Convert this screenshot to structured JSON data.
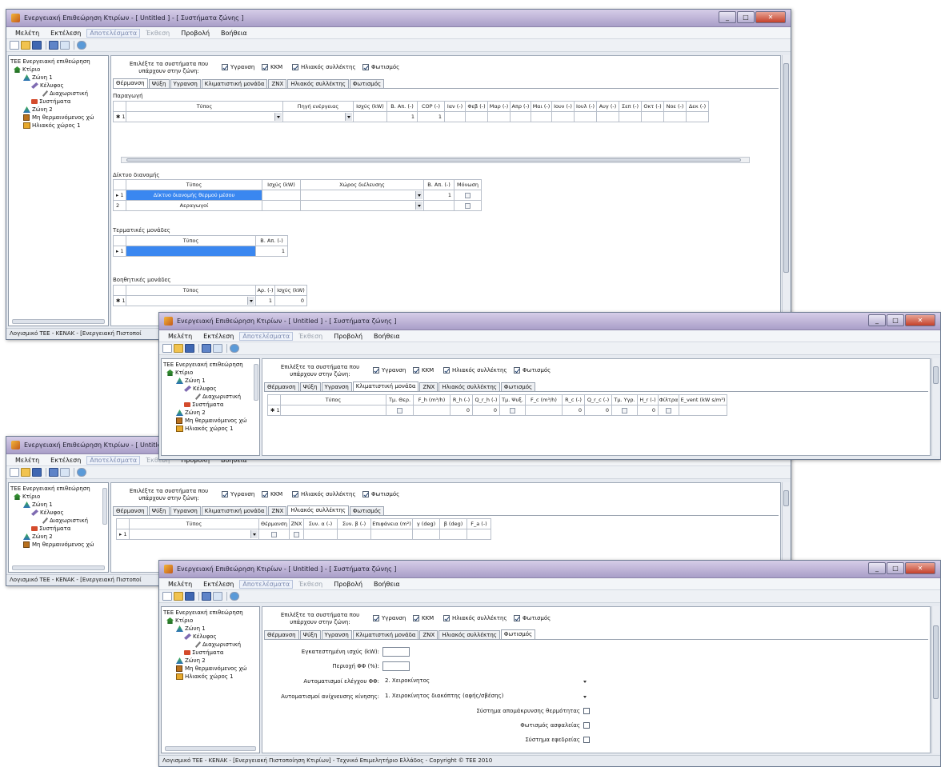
{
  "app": {
    "title": "Ενεργειακή Επιθεώρηση Κτιρίων - [ Untitled ] - [ Συστήματα ζώνης ]",
    "menu": [
      "Μελέτη",
      "Εκτέλεση",
      "Αποτελέσματα",
      "Έκθεση",
      "Προβολή",
      "Βοήθεια"
    ],
    "status_full": "Λογισμικό ΤΕΕ - KENAK - [Ενεργειακή Πιστοποίηση Κτιρίων] - Τεχνικό Επιμελητήριο Ελλάδος - Copyright © TEE 2010",
    "status_short": "Λογισμικό ΤΕΕ - KENAK - [Ενεργειακή Πιστοποί"
  },
  "tree": {
    "root": "ΤΕΕ Ενεργειακή επιθεώρηση",
    "building": "Κτίριο",
    "zone1": "Ζώνη 1",
    "shell": "Κέλυφος",
    "partitions": "Διαχωριστική",
    "systems": "Συστήματα",
    "zone2": "Ζώνη 2",
    "unheated": "Μη θερμαινόμενος χώ",
    "solar_space": "Ηλιακός χώρος 1"
  },
  "systems_select": {
    "label": "Επιλέξτε τα συστήματα που υπάρχουν στην ζώνη:",
    "options": [
      "Υγρανση",
      "ΚΚΜ",
      "Ηλιακός συλλέκτης",
      "Φωτισμός"
    ]
  },
  "tabs": [
    "Θέρμανση",
    "Ψύξη",
    "Υγρανση",
    "Κλιματιστική μονάδα",
    "ΖΝΧ",
    "Ηλιακός συλλέκτης",
    "Φωτισμός"
  ],
  "heating": {
    "production_title": "Παραγωγή",
    "production_headers": [
      "Τύπος",
      "Πηγή ενέργειας",
      "Ισχύς (kW)",
      "Β. Απ. (-)",
      "COP (-)",
      "Ιαν (-)",
      "Φεβ (-)",
      "Μαρ (-)",
      "Απρ (-)",
      "Μαι (-)",
      "Ιουν (-)",
      "Ιουλ (-)",
      "Αυγ (-)",
      "Σεπ (-)",
      "Οκτ (-)",
      "Νοε (-)",
      "Δεκ (-)"
    ],
    "production_row": {
      "marker": "✱ 1",
      "b_ap": "1",
      "cop": "1"
    },
    "distribution_title": "Δίκτυο διανομής",
    "distribution_headers": [
      "Τύπος",
      "Ισχύς (kW)",
      "Χώρος διέλευσης",
      "Β. Απ. (-)",
      "Μόνωση"
    ],
    "distribution_rows": [
      {
        "marker": "▸ 1",
        "type": "Δίκτυο διανομής θερμού μέσου",
        "b_ap": "1"
      },
      {
        "marker": "2",
        "type": "Αεραγωγοί",
        "b_ap": ""
      }
    ],
    "terminal_title": "Τερματικές μονάδες",
    "terminal_headers": [
      "Τύπος",
      "Β. Απ. (-)"
    ],
    "terminal_row": {
      "marker": "▸ 1",
      "b_ap": "1"
    },
    "aux_title": "Βοηθητικές μονάδες",
    "aux_headers": [
      "Τύπος",
      "Αρ. (-)",
      "Ισχύς (kW)"
    ],
    "aux_row": {
      "marker": "✱ 1",
      "count": "1",
      "power": "0"
    }
  },
  "ac_unit": {
    "headers": [
      "Τύπος",
      "Τμ. Θερ.",
      "F_h (m³/h)",
      "R_h (-)",
      "Q_r_h (-)",
      "Τμ. Ψυξ.",
      "F_c (m³/h)",
      "R_c (-)",
      "Q_r_c (-)",
      "Τμ. Υγρ.",
      "H_r (-)",
      "Φίλτρα",
      "E_vent (kW s/m³)"
    ],
    "row": {
      "marker": "✱ 1",
      "r_h": "0",
      "q_r_h": "0",
      "r_c": "0",
      "q_r_c": "0",
      "h_r": "0"
    }
  },
  "solar_collector": {
    "headers": [
      "Τύπος",
      "Θέρμανση",
      "ΖΝΧ",
      "Συν. α (-)",
      "Συν. β (-)",
      "Επιφάνεια (m²)",
      "γ (deg)",
      "β (deg)",
      "F_a (-)"
    ],
    "row": {
      "marker": "▸ 1"
    }
  },
  "lighting": {
    "installed_power_label": "Εγκατεστημένη ισχύς (kW):",
    "area_label": "Περιοχή ΦΦ (%):",
    "daylight_control_label": "Αυτοματισμοί ελέγχου ΦΦ:",
    "daylight_control_value": "2. Χειροκίνητος",
    "motion_control_label": "Αυτοματισμοί ανίχνευσης κίνησης:",
    "motion_control_value": "1. Χειροκίνητος διακόπτης (αφής/σβέσης)",
    "checks": [
      "Σύστημα απομάκρυνσης θερμότητας",
      "Φωτισμός ασφαλείας",
      "Σύστημα εφεδρείας"
    ]
  }
}
